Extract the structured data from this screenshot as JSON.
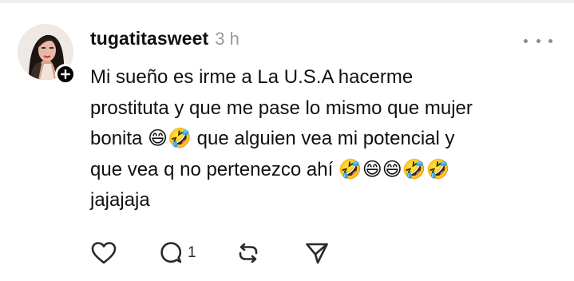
{
  "post": {
    "username": "tugatitasweet",
    "timestamp": "3 h",
    "text": "Mi sueño es irme a La U.S.A hacerme prostituta y que me pase lo mismo que mujer bonita 😄🤣 que alguien vea mi potencial y que vea q no pertenezco ahí 🤣😄😄🤣🤣 jajajaja",
    "text_lines": [
      "Mi sueño es irme a La U.S.A hacerme",
      "prostituta y que me pase lo mismo que mujer",
      "bonita 😄🤣 que alguien vea mi potencial y",
      "que vea q no pertenezco ahí 🤣😄😄🤣🤣",
      "jajajaja"
    ],
    "reply_count": "1"
  },
  "icons": {
    "follow": "plus-icon",
    "more": "more-horizontal-icon",
    "like": "heart-icon",
    "reply": "comment-icon",
    "repost": "repost-icon",
    "share": "send-icon"
  },
  "colors": {
    "text": "#101010",
    "muted": "#9a9a9a",
    "icon": "#2a2a2a",
    "badge": "#000000"
  }
}
